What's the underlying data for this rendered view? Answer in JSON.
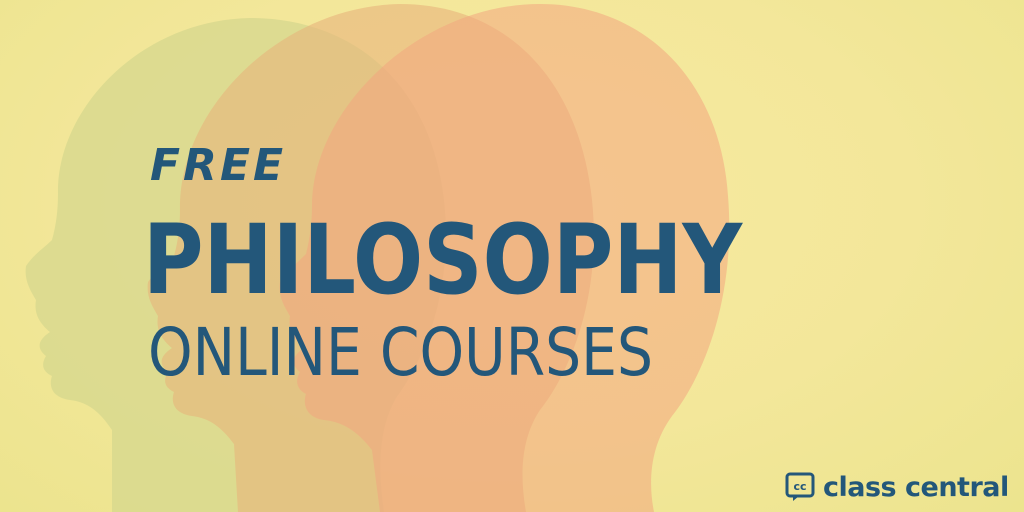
{
  "banner": {
    "line_free": "FREE",
    "line_subject": "PHILOSOPHY",
    "line_courses": "ONLINE COURSES"
  },
  "brand": {
    "icon_text": "cc",
    "name": "class central",
    "icon": "class-central-logo-icon"
  },
  "colors": {
    "background": "#f3e79a",
    "text": "#23577a",
    "head_back": "#d8d98f",
    "head_middle": "#e9b87a",
    "head_front": "#f0a57e"
  }
}
